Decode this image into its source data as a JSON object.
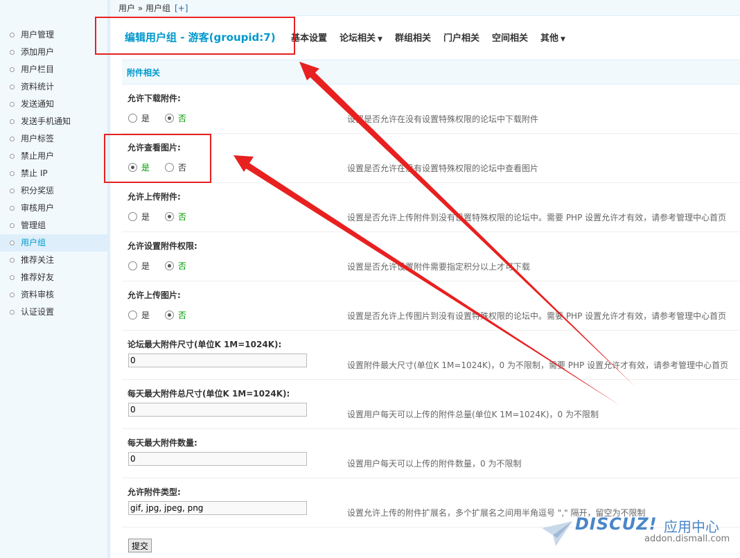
{
  "breadcrumb": {
    "path": "用户 » 用户组",
    "plus": "[+]"
  },
  "sidebar": {
    "items": [
      {
        "label": "用户管理"
      },
      {
        "label": "添加用户"
      },
      {
        "label": "用户栏目"
      },
      {
        "label": "资料统计"
      },
      {
        "label": "发送通知"
      },
      {
        "label": "发送手机通知"
      },
      {
        "label": "用户标签"
      },
      {
        "label": "禁止用户"
      },
      {
        "label": "禁止 IP"
      },
      {
        "label": "积分奖惩"
      },
      {
        "label": "审核用户"
      },
      {
        "label": "管理组"
      },
      {
        "label": "用户组"
      },
      {
        "label": "推荐关注"
      },
      {
        "label": "推荐好友"
      },
      {
        "label": "资料审核"
      },
      {
        "label": "认证设置"
      }
    ],
    "active_index": 12
  },
  "header": {
    "title": "编辑用户组 - 游客(groupid:7)",
    "tabs": [
      "基本设置",
      "论坛相关",
      "群组相关",
      "门户相关",
      "空间相关",
      "其他"
    ]
  },
  "section": {
    "title": "附件相关"
  },
  "settings": {
    "allow_download": {
      "label": "允许下载附件:",
      "yes": "是",
      "no": "否",
      "selected": "no",
      "help": "设置是否允许在没有设置特殊权限的论坛中下载附件"
    },
    "allow_view_image": {
      "label": "允许查看图片:",
      "yes": "是",
      "no": "否",
      "selected": "yes",
      "help": "设置是否允许在没有设置特殊权限的论坛中查看图片"
    },
    "allow_upload": {
      "label": "允许上传附件:",
      "yes": "是",
      "no": "否",
      "selected": "no",
      "help": "设置是否允许上传附件到没有设置特殊权限的论坛中。需要 PHP 设置允许才有效，请参考管理中心首页"
    },
    "allow_set_perm": {
      "label": "允许设置附件权限:",
      "yes": "是",
      "no": "否",
      "selected": "no",
      "help": "设置是否允许设置附件需要指定积分以上才可下载"
    },
    "allow_upload_image": {
      "label": "允许上传图片:",
      "yes": "是",
      "no": "否",
      "selected": "no",
      "help": "设置是否允许上传图片到没有设置特殊权限的论坛中。需要 PHP 设置允许才有效，请参考管理中心首页"
    },
    "max_size": {
      "label": "论坛最大附件尺寸(单位K 1M=1024K):",
      "value": "0",
      "help": "设置附件最大尺寸(单位K 1M=1024K)，0 为不限制，需要 PHP 设置允许才有效，请参考管理中心首页"
    },
    "max_daily_size": {
      "label": "每天最大附件总尺寸(单位K 1M=1024K):",
      "value": "0",
      "help": "设置用户每天可以上传的附件总量(单位K 1M=1024K)，0 为不限制"
    },
    "max_daily_count": {
      "label": "每天最大附件数量:",
      "value": "0",
      "help": "设置用户每天可以上传的附件数量，0 为不限制"
    },
    "allowed_types": {
      "label": "允许附件类型:",
      "value": "gif, jpg, jpeg, png",
      "help": "设置允许上传的附件扩展名，多个扩展名之间用半角逗号 \",\" 隔开，留空为不限制"
    }
  },
  "submit_label": "提交",
  "watermark": {
    "brand": "DISCUZ!",
    "cn": "应用中心",
    "url": "addon.dismall.com"
  },
  "colors": {
    "accent": "#0099cc",
    "annotation": "#e82020",
    "sidebar_bg": "#f2f9fd"
  }
}
